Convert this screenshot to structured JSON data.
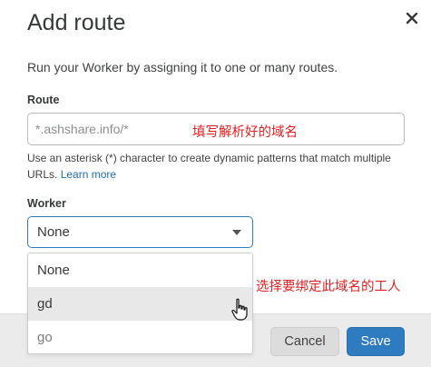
{
  "modal": {
    "title": "Add route",
    "description": "Run your Worker by assigning it to one or many routes."
  },
  "route": {
    "label": "Route",
    "placeholder": "*.ashshare.info/*",
    "value": "",
    "help_text": "Use an asterisk (*) character to create dynamic patterns that match multiple URLs.",
    "learn_more": "Learn more"
  },
  "worker": {
    "label": "Worker",
    "selected": "None",
    "options": [
      "None",
      "gd",
      "go"
    ],
    "hovered_option": "gd"
  },
  "annotations": {
    "route_note": "填写解析好的域名",
    "worker_note": "选择要绑定此域名的工人"
  },
  "footer": {
    "cancel_label": "Cancel",
    "save_label": "Save"
  },
  "colors": {
    "accent": "#2f7bbf",
    "annotation": "#e02020",
    "footer_bg": "#ebebeb"
  },
  "icons": {
    "close": "close-icon",
    "caret": "chevron-down-icon",
    "cursor": "hand-pointer-icon"
  }
}
